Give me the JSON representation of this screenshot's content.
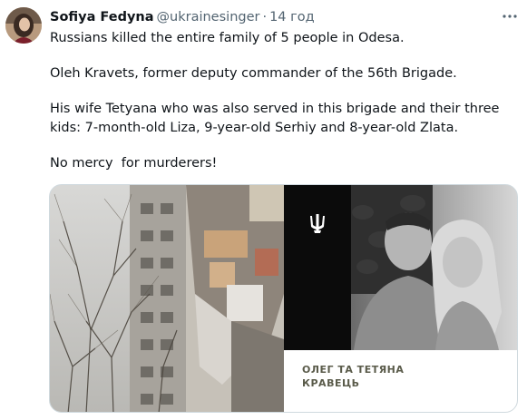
{
  "tweet": {
    "author_name": "Sofiya Fedyna",
    "author_handle": "@ukrainesinger",
    "separator": "·",
    "timestamp": "14 год",
    "more_icon": "more-horizontal-icon",
    "paragraphs": [
      "Russians killed the entire family of 5 people in Odesa.",
      "Oleh Kravets, former deputy commander of the 56th Brigade.",
      "His wife Tetyana who was also served in this brigade and their three kids: 7-month-old Liza, 9-year-old Serhiy and 8-year-old Zlata.",
      "No mercy  for murderers!"
    ],
    "media": {
      "emblem_icon": "trident-icon",
      "caption_line1": "ОЛЕГ ТА ТЕТЯНА",
      "caption_line2": "КРАВЕЦЬ"
    }
  }
}
